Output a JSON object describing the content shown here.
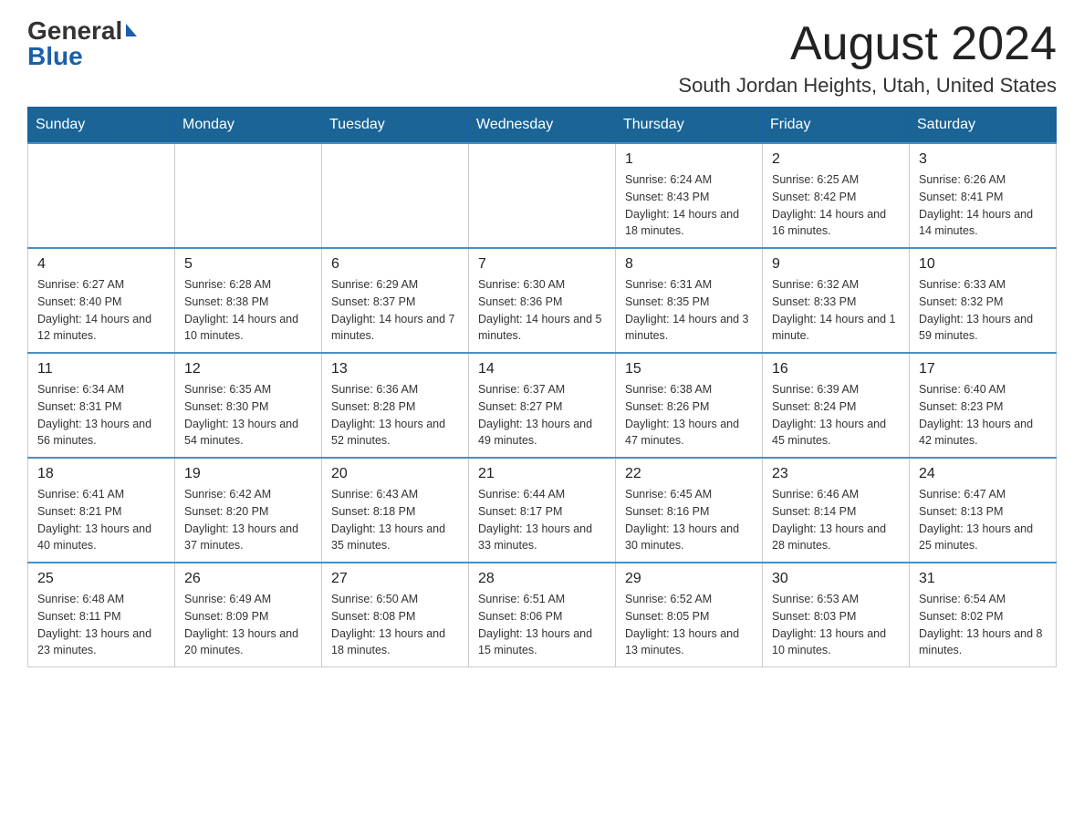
{
  "logo": {
    "general": "General",
    "blue": "Blue"
  },
  "title": "August 2024",
  "location": "South Jordan Heights, Utah, United States",
  "days_of_week": [
    "Sunday",
    "Monday",
    "Tuesday",
    "Wednesday",
    "Thursday",
    "Friday",
    "Saturday"
  ],
  "weeks": [
    [
      {
        "day": "",
        "info": ""
      },
      {
        "day": "",
        "info": ""
      },
      {
        "day": "",
        "info": ""
      },
      {
        "day": "",
        "info": ""
      },
      {
        "day": "1",
        "info": "Sunrise: 6:24 AM\nSunset: 8:43 PM\nDaylight: 14 hours and 18 minutes."
      },
      {
        "day": "2",
        "info": "Sunrise: 6:25 AM\nSunset: 8:42 PM\nDaylight: 14 hours and 16 minutes."
      },
      {
        "day": "3",
        "info": "Sunrise: 6:26 AM\nSunset: 8:41 PM\nDaylight: 14 hours and 14 minutes."
      }
    ],
    [
      {
        "day": "4",
        "info": "Sunrise: 6:27 AM\nSunset: 8:40 PM\nDaylight: 14 hours and 12 minutes."
      },
      {
        "day": "5",
        "info": "Sunrise: 6:28 AM\nSunset: 8:38 PM\nDaylight: 14 hours and 10 minutes."
      },
      {
        "day": "6",
        "info": "Sunrise: 6:29 AM\nSunset: 8:37 PM\nDaylight: 14 hours and 7 minutes."
      },
      {
        "day": "7",
        "info": "Sunrise: 6:30 AM\nSunset: 8:36 PM\nDaylight: 14 hours and 5 minutes."
      },
      {
        "day": "8",
        "info": "Sunrise: 6:31 AM\nSunset: 8:35 PM\nDaylight: 14 hours and 3 minutes."
      },
      {
        "day": "9",
        "info": "Sunrise: 6:32 AM\nSunset: 8:33 PM\nDaylight: 14 hours and 1 minute."
      },
      {
        "day": "10",
        "info": "Sunrise: 6:33 AM\nSunset: 8:32 PM\nDaylight: 13 hours and 59 minutes."
      }
    ],
    [
      {
        "day": "11",
        "info": "Sunrise: 6:34 AM\nSunset: 8:31 PM\nDaylight: 13 hours and 56 minutes."
      },
      {
        "day": "12",
        "info": "Sunrise: 6:35 AM\nSunset: 8:30 PM\nDaylight: 13 hours and 54 minutes."
      },
      {
        "day": "13",
        "info": "Sunrise: 6:36 AM\nSunset: 8:28 PM\nDaylight: 13 hours and 52 minutes."
      },
      {
        "day": "14",
        "info": "Sunrise: 6:37 AM\nSunset: 8:27 PM\nDaylight: 13 hours and 49 minutes."
      },
      {
        "day": "15",
        "info": "Sunrise: 6:38 AM\nSunset: 8:26 PM\nDaylight: 13 hours and 47 minutes."
      },
      {
        "day": "16",
        "info": "Sunrise: 6:39 AM\nSunset: 8:24 PM\nDaylight: 13 hours and 45 minutes."
      },
      {
        "day": "17",
        "info": "Sunrise: 6:40 AM\nSunset: 8:23 PM\nDaylight: 13 hours and 42 minutes."
      }
    ],
    [
      {
        "day": "18",
        "info": "Sunrise: 6:41 AM\nSunset: 8:21 PM\nDaylight: 13 hours and 40 minutes."
      },
      {
        "day": "19",
        "info": "Sunrise: 6:42 AM\nSunset: 8:20 PM\nDaylight: 13 hours and 37 minutes."
      },
      {
        "day": "20",
        "info": "Sunrise: 6:43 AM\nSunset: 8:18 PM\nDaylight: 13 hours and 35 minutes."
      },
      {
        "day": "21",
        "info": "Sunrise: 6:44 AM\nSunset: 8:17 PM\nDaylight: 13 hours and 33 minutes."
      },
      {
        "day": "22",
        "info": "Sunrise: 6:45 AM\nSunset: 8:16 PM\nDaylight: 13 hours and 30 minutes."
      },
      {
        "day": "23",
        "info": "Sunrise: 6:46 AM\nSunset: 8:14 PM\nDaylight: 13 hours and 28 minutes."
      },
      {
        "day": "24",
        "info": "Sunrise: 6:47 AM\nSunset: 8:13 PM\nDaylight: 13 hours and 25 minutes."
      }
    ],
    [
      {
        "day": "25",
        "info": "Sunrise: 6:48 AM\nSunset: 8:11 PM\nDaylight: 13 hours and 23 minutes."
      },
      {
        "day": "26",
        "info": "Sunrise: 6:49 AM\nSunset: 8:09 PM\nDaylight: 13 hours and 20 minutes."
      },
      {
        "day": "27",
        "info": "Sunrise: 6:50 AM\nSunset: 8:08 PM\nDaylight: 13 hours and 18 minutes."
      },
      {
        "day": "28",
        "info": "Sunrise: 6:51 AM\nSunset: 8:06 PM\nDaylight: 13 hours and 15 minutes."
      },
      {
        "day": "29",
        "info": "Sunrise: 6:52 AM\nSunset: 8:05 PM\nDaylight: 13 hours and 13 minutes."
      },
      {
        "day": "30",
        "info": "Sunrise: 6:53 AM\nSunset: 8:03 PM\nDaylight: 13 hours and 10 minutes."
      },
      {
        "day": "31",
        "info": "Sunrise: 6:54 AM\nSunset: 8:02 PM\nDaylight: 13 hours and 8 minutes."
      }
    ]
  ]
}
